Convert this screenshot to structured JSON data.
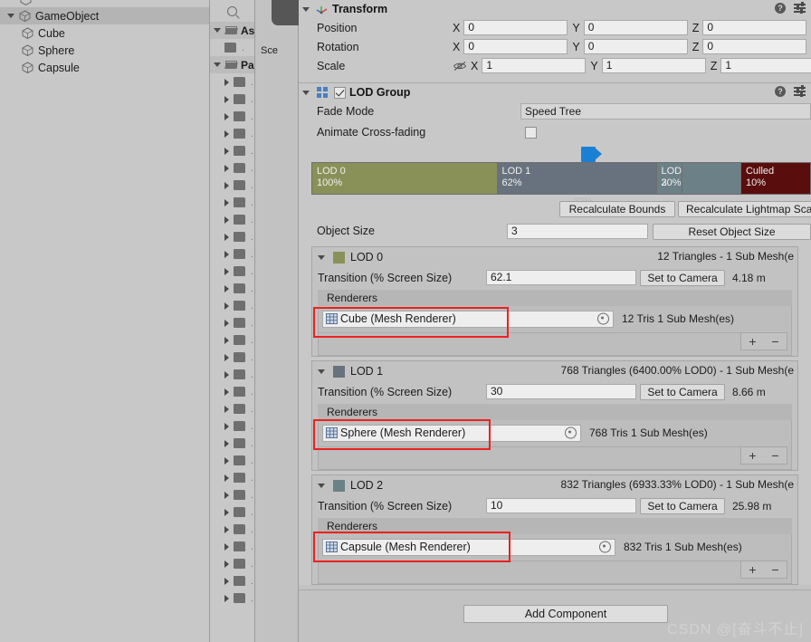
{
  "hierarchy": {
    "clipped_top_item": "",
    "items": [
      {
        "label": "GameObject",
        "level": 0,
        "expanded": true,
        "selected": true
      },
      {
        "label": "Cube",
        "level": 1,
        "expanded": false,
        "selected": false
      },
      {
        "label": "Sphere",
        "level": 1,
        "expanded": false,
        "selected": false
      },
      {
        "label": "Capsule",
        "level": 1,
        "expanded": false,
        "selected": false
      }
    ]
  },
  "project": {
    "search_placeholder": "",
    "rows": [
      {
        "label": "As",
        "folder": "open",
        "expanded": true,
        "indent": false
      },
      {
        "label": "",
        "folder": "closed",
        "expanded": false,
        "indent": true
      },
      {
        "label": "Pa",
        "folder": "open",
        "expanded": true,
        "indent": false
      },
      {
        "label": "",
        "folder": "closed",
        "expanded": false,
        "indent": true
      },
      {
        "label": "",
        "folder": "closed",
        "expanded": false,
        "indent": true
      },
      {
        "label": "",
        "folder": "closed",
        "expanded": false,
        "indent": true
      },
      {
        "label": "",
        "folder": "closed",
        "expanded": false,
        "indent": true
      },
      {
        "label": "",
        "folder": "closed",
        "expanded": false,
        "indent": true
      },
      {
        "label": "",
        "folder": "closed",
        "expanded": false,
        "indent": true
      },
      {
        "label": "",
        "folder": "closed",
        "expanded": false,
        "indent": true
      },
      {
        "label": "",
        "folder": "closed",
        "expanded": false,
        "indent": true
      },
      {
        "label": "",
        "folder": "closed",
        "expanded": false,
        "indent": true
      },
      {
        "label": "",
        "folder": "closed",
        "expanded": false,
        "indent": true
      },
      {
        "label": "",
        "folder": "closed",
        "expanded": false,
        "indent": true
      },
      {
        "label": "",
        "folder": "closed",
        "expanded": false,
        "indent": true
      },
      {
        "label": "",
        "folder": "closed",
        "expanded": false,
        "indent": true
      },
      {
        "label": "",
        "folder": "closed",
        "expanded": false,
        "indent": true
      },
      {
        "label": "",
        "folder": "closed",
        "expanded": false,
        "indent": true
      }
    ]
  },
  "scene_tab": {
    "label": "Sce"
  },
  "inspector": {
    "transform": {
      "title": "Transform",
      "rows": [
        {
          "label": "Position",
          "x": "0",
          "y": "0",
          "z": "0",
          "has_eye": false
        },
        {
          "label": "Rotation",
          "x": "0",
          "y": "0",
          "z": "0",
          "has_eye": false
        },
        {
          "label": "Scale",
          "x": "1",
          "y": "1",
          "z": "1",
          "has_eye": true
        }
      ],
      "axis_labels": {
        "x": "X",
        "y": "Y",
        "z": "Z"
      }
    },
    "lod_group": {
      "title": "LOD Group",
      "enabled": true,
      "fade_mode": {
        "label": "Fade Mode",
        "value": "Speed Tree"
      },
      "animate_cross_fading": {
        "label": "Animate Cross-fading",
        "checked": false
      },
      "bar": {
        "camera_percent": "22%",
        "segments": [
          {
            "name": "LOD 0",
            "percent": "100%",
            "color": "#8a9158",
            "width_pct": 37.0
          },
          {
            "name": "LOD 1",
            "percent": "62%",
            "color": "#68727e",
            "width_pct": 32.0
          },
          {
            "name": "LOD 2",
            "percent": "30%",
            "color": "#6c8087",
            "width_pct": 5.2
          },
          {
            "name": "",
            "percent": "",
            "color": "#6c8087",
            "width_pct": 11.8
          },
          {
            "name": "Culled",
            "percent": "10%",
            "color": "#5a0d0d",
            "width_pct": 14.0
          }
        ]
      },
      "recalculate_bounds_label": "Recalculate Bounds",
      "recalculate_lightmap_label": "Recalculate Lightmap Sca",
      "object_size": {
        "label": "Object Size",
        "value": "3"
      },
      "reset_object_size_label": "Reset Object Size",
      "levels": [
        {
          "name": "LOD 0",
          "swatch": "#8a9158",
          "stats": "12 Triangles  - 1 Sub Mesh(e",
          "transition_label": "Transition (% Screen Size)",
          "transition_value": "62.1",
          "set_to_camera_label": "Set to Camera",
          "distance": "4.18 m",
          "renderers_label": "Renderers",
          "renderer_name": "Cube (Mesh Renderer)",
          "renderer_stats": "12 Tris  1 Sub Mesh(es)",
          "add_label": "+",
          "remove_label": "−"
        },
        {
          "name": "LOD 1",
          "swatch": "#68727e",
          "stats": "768 Triangles (6400.00% LOD0) - 1 Sub Mesh(e",
          "transition_label": "Transition (% Screen Size)",
          "transition_value": "30",
          "set_to_camera_label": "Set to Camera",
          "distance": "8.66 m",
          "renderers_label": "Renderers",
          "renderer_name": "Sphere (Mesh Renderer)",
          "renderer_stats": "768 Tris  1 Sub Mesh(es)",
          "add_label": "+",
          "remove_label": "−"
        },
        {
          "name": "LOD 2",
          "swatch": "#6c8087",
          "stats": "832 Triangles (6933.33% LOD0) - 1 Sub Mesh(e",
          "transition_label": "Transition (% Screen Size)",
          "transition_value": "10",
          "set_to_camera_label": "Set to Camera",
          "distance": "25.98 m",
          "renderers_label": "Renderers",
          "renderer_name": "Capsule (Mesh Renderer)",
          "renderer_stats": "832 Tris  1 Sub Mesh(es)",
          "add_label": "+",
          "remove_label": "−"
        }
      ]
    },
    "add_component_label": "Add Component"
  },
  "watermark": "CSDN @[奋斗不止]"
}
